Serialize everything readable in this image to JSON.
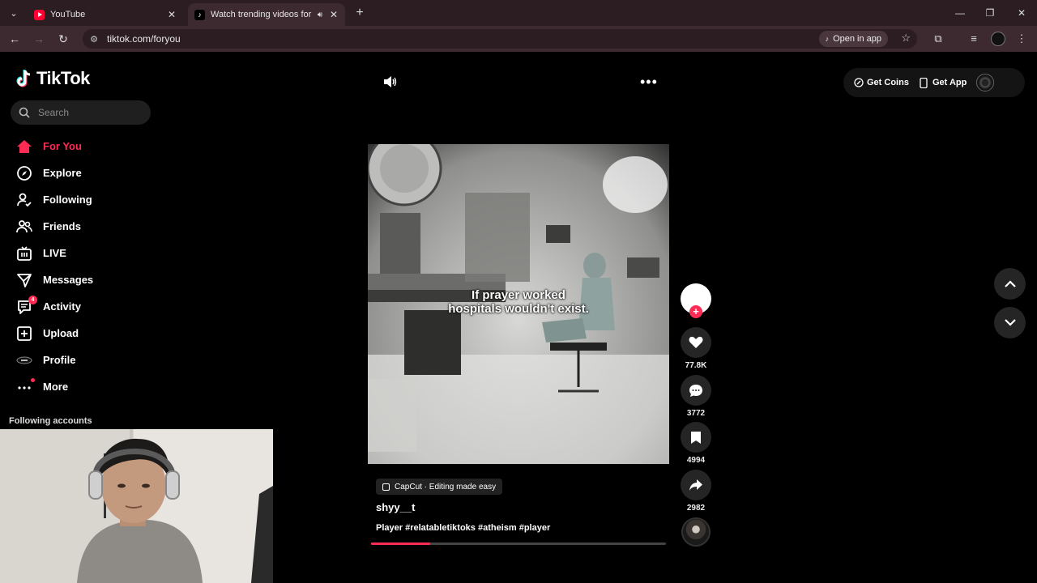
{
  "browser": {
    "tabs": [
      {
        "title": "YouTube"
      },
      {
        "title": "Watch trending videos for y"
      }
    ],
    "url": "tiktok.com/foryou",
    "open_in_app": "Open in app"
  },
  "tiktok": {
    "logo": "TikTok",
    "search_placeholder": "Search",
    "nav": [
      {
        "label": "For You",
        "icon": "home-icon"
      },
      {
        "label": "Explore",
        "icon": "compass-icon"
      },
      {
        "label": "Following",
        "icon": "following-icon"
      },
      {
        "label": "Friends",
        "icon": "friends-icon"
      },
      {
        "label": "LIVE",
        "icon": "live-icon"
      },
      {
        "label": "Messages",
        "icon": "messages-icon"
      },
      {
        "label": "Activity",
        "icon": "activity-icon",
        "badge": "4"
      },
      {
        "label": "Upload",
        "icon": "upload-icon"
      },
      {
        "label": "Profile",
        "icon": "profile-icon"
      },
      {
        "label": "More",
        "icon": "more-icon"
      }
    ],
    "following_accounts": "Following accounts",
    "top_right": {
      "get_coins": "Get Coins",
      "get_app": "Get App"
    },
    "video": {
      "caption_line1": "If prayer worked",
      "caption_line2": "hospitals wouldn't exist.",
      "info_pill": "CapCut · Editing made easy",
      "author": "shyy__t",
      "description": "Player #relatabletiktoks #atheism #player",
      "progress_fraction": 0.2
    },
    "actions": {
      "likes": "77.8K",
      "comments": "3772",
      "saves": "4994",
      "shares": "2982"
    },
    "accent_color": "#fe2c55"
  }
}
